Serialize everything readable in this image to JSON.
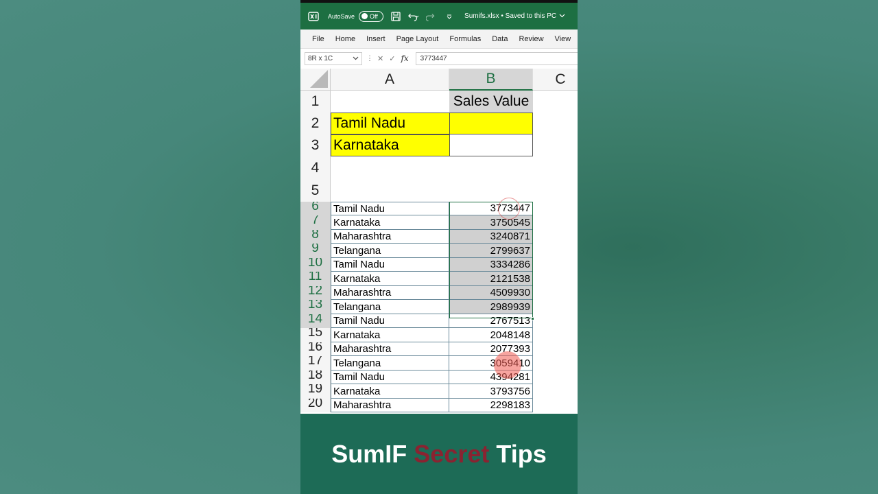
{
  "titlebar": {
    "autosave_label": "AutoSave",
    "toggle_state": "Off",
    "filename": "Sumifs.xlsx • Saved to this PC"
  },
  "ribbon": {
    "tabs": [
      "File",
      "Home",
      "Insert",
      "Page Layout",
      "Formulas",
      "Data",
      "Review",
      "View"
    ]
  },
  "formula_bar": {
    "name_box": "8R x 1C",
    "fx_label": "fx",
    "value": "3773447"
  },
  "sheet": {
    "columns": [
      "A",
      "B",
      "C"
    ],
    "rows": [
      {
        "n": "1",
        "a": "",
        "b": "Sales Value"
      },
      {
        "n": "2",
        "a": "Tamil Nadu",
        "b": ""
      },
      {
        "n": "3",
        "a": "Karnataka",
        "b": ""
      },
      {
        "n": "4",
        "a": "",
        "b": ""
      },
      {
        "n": "5",
        "a": "",
        "b": ""
      },
      {
        "n": "6",
        "a": "Tamil Nadu",
        "b": "3773447"
      },
      {
        "n": "7",
        "a": "Karnataka",
        "b": "3750545"
      },
      {
        "n": "8",
        "a": "Maharashtra",
        "b": "3240871"
      },
      {
        "n": "9",
        "a": "Telangana",
        "b": "2799637"
      },
      {
        "n": "10",
        "a": "Tamil Nadu",
        "b": "3334286"
      },
      {
        "n": "11",
        "a": "Karnataka",
        "b": "2121538"
      },
      {
        "n": "12",
        "a": "Maharashtra",
        "b": "4509930"
      },
      {
        "n": "13",
        "a": "Telangana",
        "b": "2989939"
      },
      {
        "n": "14",
        "a": "Tamil Nadu",
        "b": "2767513"
      },
      {
        "n": "15",
        "a": "Karnataka",
        "b": "2048148"
      },
      {
        "n": "16",
        "a": "Maharashtra",
        "b": "2077393"
      },
      {
        "n": "17",
        "a": "Telangana",
        "b": "3059410"
      },
      {
        "n": "18",
        "a": "Tamil Nadu",
        "b": "4394281"
      },
      {
        "n": "19",
        "a": "Karnataka",
        "b": "3793756"
      },
      {
        "n": "20",
        "a": "Maharashtra",
        "b": "2298183"
      }
    ]
  },
  "caption": {
    "part1": "SumIF",
    "part2": "Secret",
    "part3": "Tips"
  },
  "colors": {
    "excel_green": "#1d6f42",
    "highlight_yellow": "#ffff00",
    "selection_gray": "#d0d0d0",
    "caption_accent": "#8a2331"
  }
}
